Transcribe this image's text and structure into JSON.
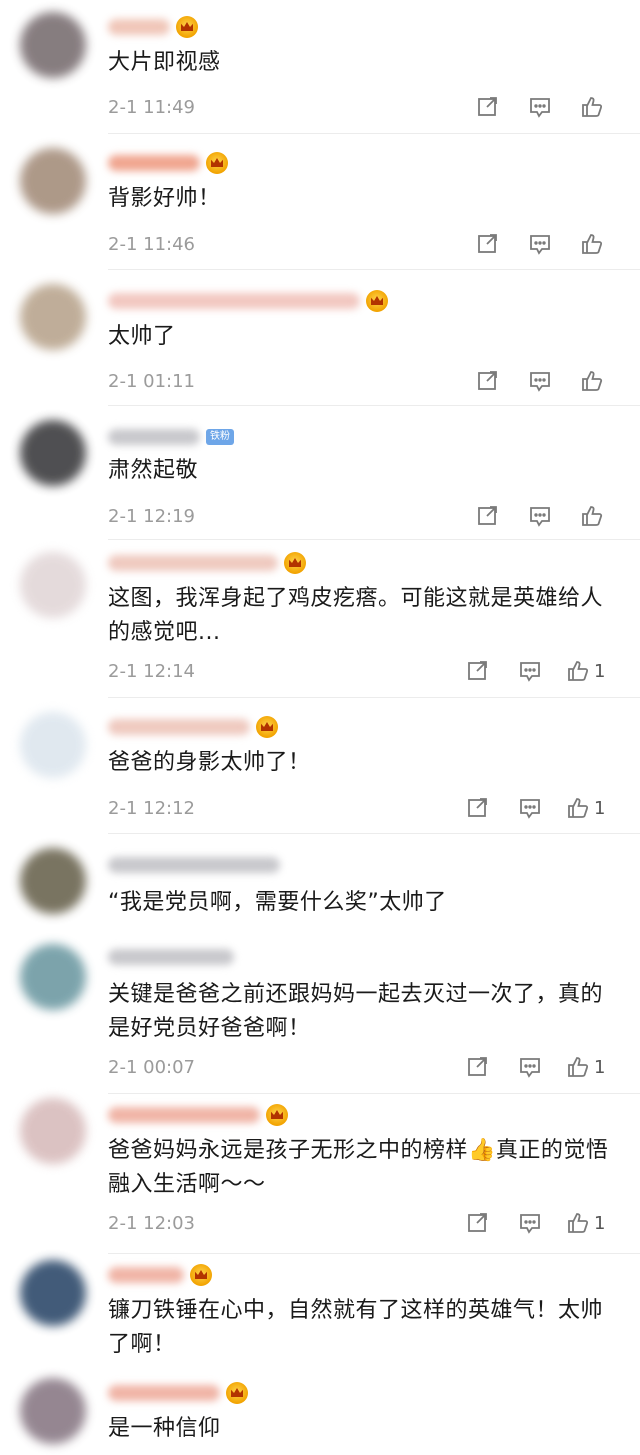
{
  "comments": [
    {
      "text": "大片即视感",
      "time": "2-1 11:49",
      "likes": "",
      "badge": "crown",
      "avatar_color": "#7a6f72"
    },
    {
      "text": "背影好帅！",
      "time": "2-1 11:46",
      "likes": "",
      "badge": "crown",
      "avatar_color": "#a58e7c"
    },
    {
      "text": "太帅了",
      "time": "2-1 01:11",
      "likes": "",
      "badge": "crown",
      "avatar_color": "#b9a58e"
    },
    {
      "text": "肃然起敬",
      "time": "2-1 12:19",
      "likes": "",
      "badge": "铁粉",
      "avatar_color": "#3d3d40"
    },
    {
      "text": "这图，我浑身起了鸡皮疙瘩。可能这就是英雄给人的感觉吧...",
      "time": "2-1 12:14",
      "likes": "1",
      "badge": "crown",
      "avatar_color": "#e2d7d8"
    },
    {
      "text": "爸爸的身影太帅了！",
      "time": "2-1 12:12",
      "likes": "1",
      "badge": "crown",
      "avatar_color": "#dde6ee"
    },
    {
      "text": "“我是党员啊，需要什么奖”太帅了",
      "time": "",
      "likes": "",
      "badge": "",
      "avatar_color": "#6b6550"
    },
    {
      "text": "关键是爸爸之前还跟妈妈一起去灭过一次了，真的是好党员好爸爸啊！",
      "time": "2-1 00:07",
      "likes": "1",
      "badge": "",
      "avatar_color": "#6e9aa3"
    },
    {
      "text": "爸爸妈妈永远是孩子无形之中的榜样👍真正的觉悟融入生活啊～～",
      "time": "2-1 12:03",
      "likes": "1",
      "badge": "crown",
      "avatar_color": "#d8bcbc"
    },
    {
      "text": "镰刀铁锤在心中，自然就有了这样的英雄气！太帅了啊！",
      "time": "",
      "likes": "",
      "badge": "crown",
      "avatar_color": "#2e4a6b"
    },
    {
      "text": "是一种信仰",
      "time": "",
      "likes": "",
      "badge": "crown",
      "avatar_color": "#8a7a86"
    }
  ],
  "icons": {
    "share": "share-icon",
    "comment": "comment-icon",
    "like": "like-icon",
    "crown": "crown-icon"
  },
  "colors": {
    "time": "#9b9b9b",
    "icon": "#7a7a7a",
    "crown": "#f2a300",
    "fan_badge": "#6ea6e8"
  }
}
